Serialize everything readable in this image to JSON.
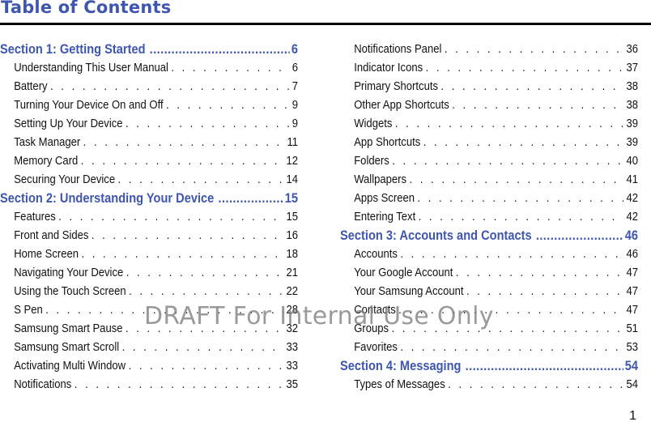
{
  "title": "Table of Contents",
  "watermark": "DRAFT For Internal Use Only",
  "page_number": "1",
  "colors": {
    "heading": "#3f56b0",
    "text": "#111111",
    "rule": "#000000"
  },
  "left_column": [
    {
      "type": "section",
      "label": "Section 1:  Getting Started",
      "page": "6"
    },
    {
      "type": "entry",
      "label": "Understanding This User Manual",
      "page": "6"
    },
    {
      "type": "entry",
      "label": "Battery",
      "page": "7"
    },
    {
      "type": "entry",
      "label": "Turning Your Device On and Off",
      "page": "9"
    },
    {
      "type": "entry",
      "label": "Setting Up Your Device",
      "page": "9"
    },
    {
      "type": "entry",
      "label": "Task Manager",
      "page": "11"
    },
    {
      "type": "entry",
      "label": "Memory Card",
      "page": "12"
    },
    {
      "type": "entry",
      "label": "Securing Your Device",
      "page": "14"
    },
    {
      "type": "section",
      "label": "Section 2:  Understanding Your Device",
      "page": "15"
    },
    {
      "type": "entry",
      "label": "Features",
      "page": "15"
    },
    {
      "type": "entry",
      "label": "Front and Sides",
      "page": "16"
    },
    {
      "type": "entry",
      "label": "Home Screen",
      "page": "18"
    },
    {
      "type": "entry",
      "label": "Navigating Your Device",
      "page": "21"
    },
    {
      "type": "entry",
      "label": "Using the Touch Screen",
      "page": "22"
    },
    {
      "type": "entry",
      "label": "S Pen",
      "page": "28"
    },
    {
      "type": "entry",
      "label": "Samsung Smart Pause",
      "page": "32"
    },
    {
      "type": "entry",
      "label": "Samsung Smart Scroll",
      "page": "33"
    },
    {
      "type": "entry",
      "label": "Activating Multi Window",
      "page": "33"
    },
    {
      "type": "entry",
      "label": "Notifications",
      "page": "35"
    }
  ],
  "right_column": [
    {
      "type": "entry",
      "label": "Notifications Panel",
      "page": "36"
    },
    {
      "type": "entry",
      "label": "Indicator Icons",
      "page": "37"
    },
    {
      "type": "entry",
      "label": "Primary Shortcuts",
      "page": "38"
    },
    {
      "type": "entry",
      "label": "Other App Shortcuts",
      "page": "38"
    },
    {
      "type": "entry",
      "label": "Widgets",
      "page": "39"
    },
    {
      "type": "entry",
      "label": "App Shortcuts",
      "page": "39"
    },
    {
      "type": "entry",
      "label": "Folders",
      "page": "40"
    },
    {
      "type": "entry",
      "label": "Wallpapers",
      "page": "41"
    },
    {
      "type": "entry",
      "label": "Apps Screen",
      "page": "42"
    },
    {
      "type": "entry",
      "label": "Entering Text",
      "page": "42"
    },
    {
      "type": "section",
      "label": "Section 3:  Accounts and Contacts",
      "page": "46"
    },
    {
      "type": "entry",
      "label": "Accounts",
      "page": "46"
    },
    {
      "type": "entry",
      "label": "Your Google Account",
      "page": "47"
    },
    {
      "type": "entry",
      "label": "Your Samsung Account",
      "page": "47"
    },
    {
      "type": "entry",
      "label": "Contacts",
      "page": "47"
    },
    {
      "type": "entry",
      "label": "Groups",
      "page": "51"
    },
    {
      "type": "entry",
      "label": "Favorites",
      "page": "53"
    },
    {
      "type": "section",
      "label": "Section 4:  Messaging",
      "page": "54"
    },
    {
      "type": "entry",
      "label": "Types of Messages",
      "page": "54"
    }
  ]
}
